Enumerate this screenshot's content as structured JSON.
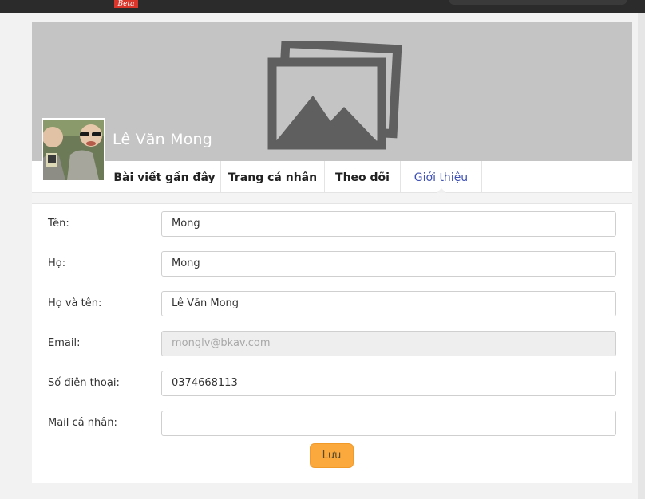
{
  "header": {
    "badge": "Beta"
  },
  "profile": {
    "display_name": "Lê Văn Mong"
  },
  "tabs": [
    {
      "label": "Bài viết gần đây"
    },
    {
      "label": "Trang cá nhân"
    },
    {
      "label": "Theo dõi"
    },
    {
      "label": "Giới thiệu",
      "active": true
    }
  ],
  "form": {
    "fields": [
      {
        "label": "Tên:",
        "value": "Mong"
      },
      {
        "label": "Họ:",
        "value": "Mong"
      },
      {
        "label": "Họ và tên:",
        "value": "Lê Văn Mong"
      },
      {
        "label": "Email:",
        "value": "monglv@bkav.com",
        "disabled": true
      },
      {
        "label": "Số điện thoại:",
        "value": "0374668113"
      },
      {
        "label": "Mail cá nhân:",
        "value": ""
      }
    ],
    "save_label": "Lưu"
  },
  "colors": {
    "accent_tab": "#3f51b5",
    "save_button": "#fba93c",
    "cover_bg": "#c4c4c4",
    "badge": "#d9352b"
  },
  "icons": {
    "cover_placeholder": "image-placeholder-icon"
  }
}
